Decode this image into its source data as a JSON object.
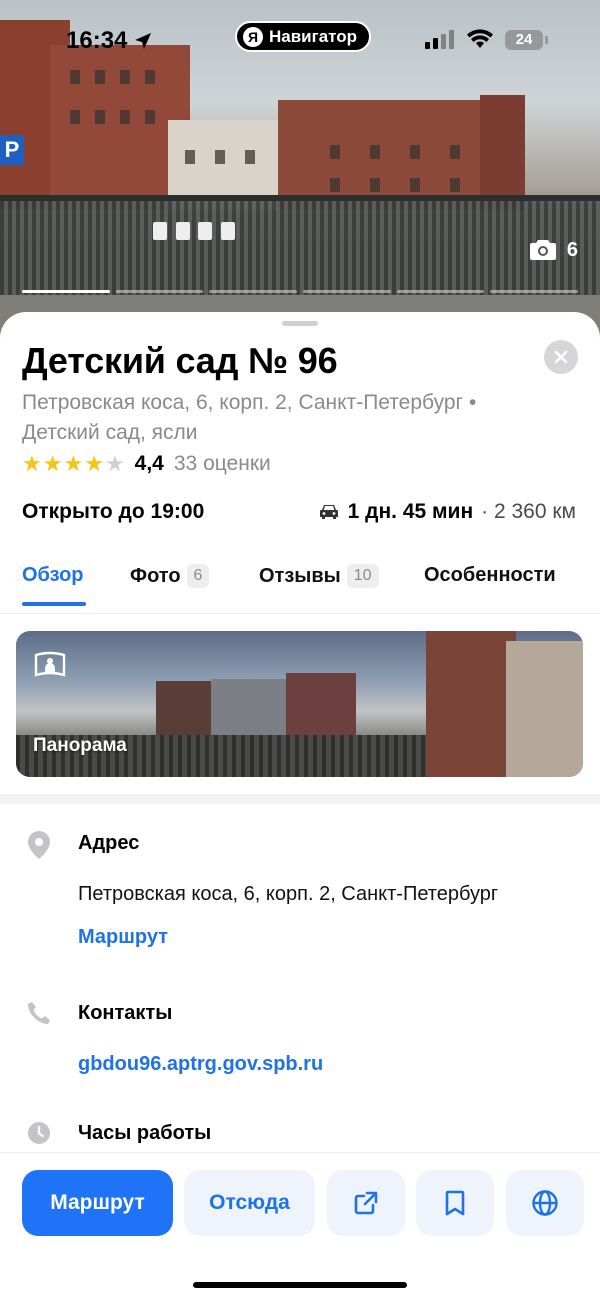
{
  "status_bar": {
    "time": "16:34",
    "app_pill": "Навигатор",
    "app_pill_logo": "Я",
    "battery": "24"
  },
  "hero": {
    "photo_count": "6",
    "photo_index": 1,
    "photo_total": 6
  },
  "place": {
    "title": "Детский сад № 96",
    "subtitle": "Петровская коса, 6, корп. 2, Санкт-Петербург • Детский сад, ясли",
    "rating_value": "4,4",
    "rating_stars": 4,
    "rating_count": "33 оценки",
    "hours": "Открыто до 19:00",
    "travel_time": "1 дн. 45 мин",
    "travel_distance": "· 2 360 км"
  },
  "tabs": [
    {
      "label": "Обзор",
      "badge": ""
    },
    {
      "label": "Фото",
      "badge": "6"
    },
    {
      "label": "Отзывы",
      "badge": "10"
    },
    {
      "label": "Особенности",
      "badge": ""
    }
  ],
  "panorama": {
    "label": "Панорама"
  },
  "address": {
    "label": "Адрес",
    "value": "Петровская коса, 6, корп. 2, Санкт-Петербург",
    "link": "Маршрут"
  },
  "contacts": {
    "label": "Контакты",
    "website": "gbdou96.aptrg.gov.spb.ru"
  },
  "hours_section": {
    "label": "Часы работы"
  },
  "actions": {
    "route": "Маршрут",
    "from_here": "Отсюда"
  },
  "colors": {
    "accent": "#1e73e8",
    "primary_button": "#1e73f6",
    "star": "#f5c518",
    "muted_text": "#8a8a8e"
  },
  "icons": [
    "navigation-arrow-icon",
    "signal-icon",
    "wifi-icon",
    "camera-icon",
    "close-icon",
    "star-icon",
    "car-icon",
    "panorama-icon",
    "location-pin-icon",
    "phone-icon",
    "clock-icon",
    "share-icon",
    "bookmark-icon",
    "globe-icon"
  ]
}
